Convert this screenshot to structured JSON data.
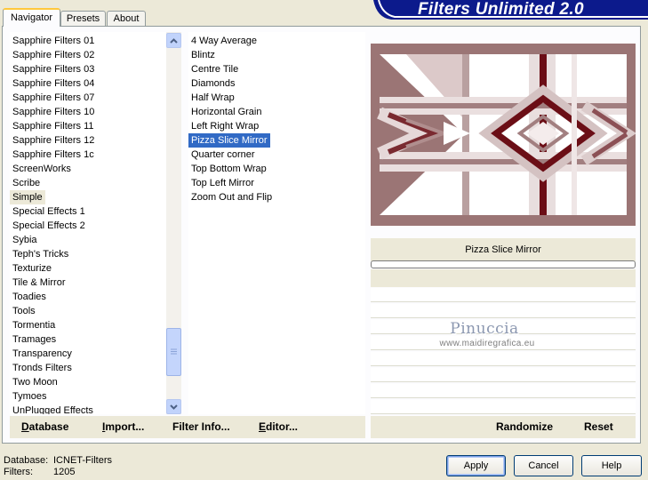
{
  "header": {
    "title": "Filters Unlimited 2.0"
  },
  "tabs": [
    {
      "label": "Navigator",
      "active": true
    },
    {
      "label": "Presets",
      "active": false
    },
    {
      "label": "About",
      "active": false
    }
  ],
  "categories": {
    "items": [
      "Sapphire Filters 01",
      "Sapphire Filters 02",
      "Sapphire Filters 03",
      "Sapphire Filters 04",
      "Sapphire Filters 07",
      "Sapphire Filters 10",
      "Sapphire Filters 11",
      "Sapphire Filters 12",
      "Sapphire Filters 1c",
      "ScreenWorks",
      "Scribe",
      "Simple",
      "Special Effects 1",
      "Special Effects 2",
      "Sybia",
      "Teph's Tricks",
      "Texturize",
      "Tile & Mirror",
      "Toadies",
      "Tools",
      "Tormentia",
      "Tramages",
      "Transparency",
      "Tronds Filters",
      "Two Moon",
      "Tymoes",
      "UnPlugged Effects"
    ],
    "selected": "Simple"
  },
  "filters": {
    "items": [
      "4 Way Average",
      "Blintz",
      "Centre Tile",
      "Diamonds",
      "Half Wrap",
      "Horizontal Grain",
      "Left Right Wrap",
      "Pizza Slice Mirror",
      "Quarter corner",
      "Top Bottom Wrap",
      "Top Left Mirror",
      "Zoom Out and Flip"
    ],
    "selected": "Pizza Slice Mirror"
  },
  "left_buttons": {
    "database": "Database",
    "import": "Import...",
    "filter_info": "Filter Info...",
    "editor": "Editor..."
  },
  "preview": {
    "filter_name": "Pizza Slice Mirror",
    "randomize": "Randomize",
    "reset": "Reset",
    "watermark": "Pinuccia",
    "watermark_sub": "www.maidiregrafica.eu",
    "colors": {
      "dark": "#6b0e16",
      "mid": "#9b7575",
      "light": "#f4ecec"
    }
  },
  "status": {
    "database_label": "Database:",
    "database_value": "ICNET-Filters",
    "filters_label": "Filters:",
    "filters_value": "1205"
  },
  "dialog_buttons": {
    "apply": "Apply",
    "cancel": "Cancel",
    "help": "Help"
  }
}
